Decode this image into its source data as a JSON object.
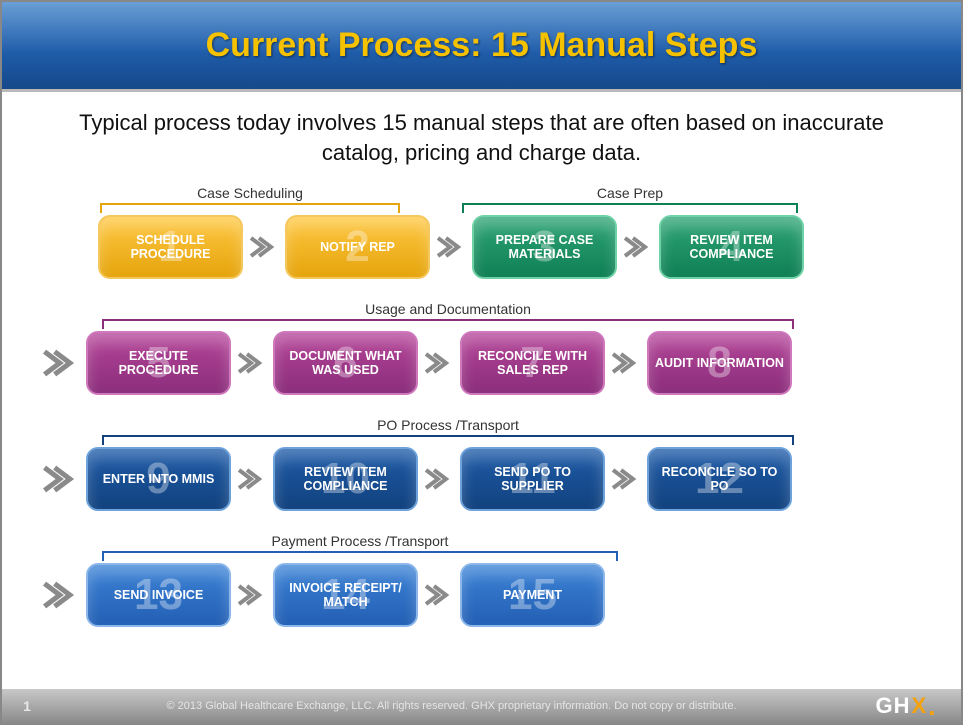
{
  "header": {
    "title": "Current Process: 15 Manual Steps"
  },
  "subhead": "Typical process today involves 15 manual steps that are often based on inaccurate catalog, pricing and charge data.",
  "groups": [
    {
      "label": "Case Scheduling",
      "color": "#e5a40c"
    },
    {
      "label": "Case Prep",
      "color": "#0f7f56"
    },
    {
      "label": "Usage and Documentation",
      "color": "#8b2e7b"
    },
    {
      "label": "PO Process /Transport",
      "color": "#12427e"
    },
    {
      "label": "Payment Process /Transport",
      "color": "#235fb4"
    }
  ],
  "steps": [
    {
      "n": "1",
      "label": "SCHEDULE PROCEDURE",
      "group": 0
    },
    {
      "n": "2",
      "label": "NOTIFY REP",
      "group": 0
    },
    {
      "n": "3",
      "label": "PREPARE CASE MATERIALS",
      "group": 1
    },
    {
      "n": "4",
      "label": "REVIEW ITEM COMPLIANCE",
      "group": 1
    },
    {
      "n": "5",
      "label": "EXECUTE PROCEDURE",
      "group": 2
    },
    {
      "n": "6",
      "label": "DOCUMENT WHAT WAS USED",
      "group": 2
    },
    {
      "n": "7",
      "label": "RECONCILE WITH SALES REP",
      "group": 2
    },
    {
      "n": "8",
      "label": "AUDIT INFORMATION",
      "group": 2
    },
    {
      "n": "9",
      "label": "ENTER INTO MMIS",
      "group": 3
    },
    {
      "n": "10",
      "label": "REVIEW ITEM COMPLIANCE",
      "group": 3
    },
    {
      "n": "11",
      "label": "SEND PO TO SUPPLIER",
      "group": 3
    },
    {
      "n": "12",
      "label": "RECONCILE SO TO PO",
      "group": 3
    },
    {
      "n": "13",
      "label": "SEND INVOICE",
      "group": 4
    },
    {
      "n": "14",
      "label": "INVOICE RECEIPT/ MATCH",
      "group": 4
    },
    {
      "n": "15",
      "label": "PAYMENT",
      "group": 4
    }
  ],
  "footer": {
    "page": "1",
    "copyright": "© 2013 Global Healthcare Exchange, LLC.  All rights reserved. GHX proprietary information. Do not copy or distribute.",
    "logo_text": "GHX"
  },
  "colors": {
    "arrow": "#8a8a8a",
    "orange": "#e5a40c",
    "green": "#0f7f56",
    "purple": "#8b2e7b",
    "navy": "#12427e",
    "blue": "#235fb4"
  }
}
